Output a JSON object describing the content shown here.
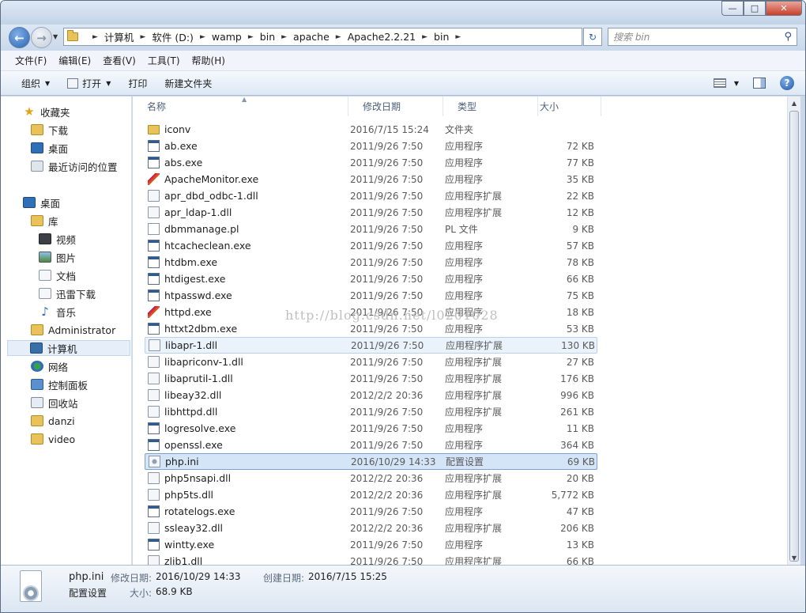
{
  "window": {
    "min_glyph": "—",
    "max_glyph": "□",
    "close_glyph": "✕"
  },
  "address": {
    "crumbs": [
      "计算机",
      "软件 (D:)",
      "wamp",
      "bin",
      "apache",
      "Apache2.2.21",
      "bin"
    ],
    "search_placeholder": "搜索 bin"
  },
  "menu": [
    "文件(F)",
    "编辑(E)",
    "查看(V)",
    "工具(T)",
    "帮助(H)"
  ],
  "commands": {
    "organize": "组织",
    "open": "打开",
    "print": "打印",
    "new_folder": "新建文件夹"
  },
  "nav": {
    "favorites": "收藏夹",
    "downloads": "下载",
    "desktop_fav": "桌面",
    "recent": "最近访问的位置",
    "desktop": "桌面",
    "libraries": "库",
    "videos": "视频",
    "pictures": "图片",
    "documents": "文档",
    "xunlei": "迅雷下载",
    "music": "音乐",
    "admin": "Administrator",
    "computer": "计算机",
    "network": "网络",
    "control_panel": "控制面板",
    "recycle": "回收站",
    "danzi": "danzi",
    "video": "video"
  },
  "columns": {
    "name": "名称",
    "date": "修改日期",
    "type": "类型",
    "size": "大小"
  },
  "files": [
    {
      "name": "iconv",
      "date": "2016/7/15 15:24",
      "type": "文件夹",
      "size": "",
      "icon": "folder"
    },
    {
      "name": "ab.exe",
      "date": "2011/9/26 7:50",
      "type": "应用程序",
      "size": "72 KB",
      "icon": "exe"
    },
    {
      "name": "abs.exe",
      "date": "2011/9/26 7:50",
      "type": "应用程序",
      "size": "77 KB",
      "icon": "exe"
    },
    {
      "name": "ApacheMonitor.exe",
      "date": "2011/9/26 7:50",
      "type": "应用程序",
      "size": "35 KB",
      "icon": "feather"
    },
    {
      "name": "apr_dbd_odbc-1.dll",
      "date": "2011/9/26 7:50",
      "type": "应用程序扩展",
      "size": "22 KB",
      "icon": "dll"
    },
    {
      "name": "apr_ldap-1.dll",
      "date": "2011/9/26 7:50",
      "type": "应用程序扩展",
      "size": "12 KB",
      "icon": "dll"
    },
    {
      "name": "dbmmanage.pl",
      "date": "2011/9/26 7:50",
      "type": "PL 文件",
      "size": "9 KB",
      "icon": "pl"
    },
    {
      "name": "htcacheclean.exe",
      "date": "2011/9/26 7:50",
      "type": "应用程序",
      "size": "57 KB",
      "icon": "exe"
    },
    {
      "name": "htdbm.exe",
      "date": "2011/9/26 7:50",
      "type": "应用程序",
      "size": "78 KB",
      "icon": "exe"
    },
    {
      "name": "htdigest.exe",
      "date": "2011/9/26 7:50",
      "type": "应用程序",
      "size": "66 KB",
      "icon": "exe"
    },
    {
      "name": "htpasswd.exe",
      "date": "2011/9/26 7:50",
      "type": "应用程序",
      "size": "75 KB",
      "icon": "exe"
    },
    {
      "name": "httpd.exe",
      "date": "2011/9/26 7:50",
      "type": "应用程序",
      "size": "18 KB",
      "icon": "feather"
    },
    {
      "name": "httxt2dbm.exe",
      "date": "2011/9/26 7:50",
      "type": "应用程序",
      "size": "53 KB",
      "icon": "exe"
    },
    {
      "name": "libapr-1.dll",
      "date": "2011/9/26 7:50",
      "type": "应用程序扩展",
      "size": "130 KB",
      "icon": "dll",
      "state": "hl"
    },
    {
      "name": "libapriconv-1.dll",
      "date": "2011/9/26 7:50",
      "type": "应用程序扩展",
      "size": "27 KB",
      "icon": "dll"
    },
    {
      "name": "libaprutil-1.dll",
      "date": "2011/9/26 7:50",
      "type": "应用程序扩展",
      "size": "176 KB",
      "icon": "dll"
    },
    {
      "name": "libeay32.dll",
      "date": "2012/2/2 20:36",
      "type": "应用程序扩展",
      "size": "996 KB",
      "icon": "dll"
    },
    {
      "name": "libhttpd.dll",
      "date": "2011/9/26 7:50",
      "type": "应用程序扩展",
      "size": "261 KB",
      "icon": "dll"
    },
    {
      "name": "logresolve.exe",
      "date": "2011/9/26 7:50",
      "type": "应用程序",
      "size": "11 KB",
      "icon": "exe"
    },
    {
      "name": "openssl.exe",
      "date": "2011/9/26 7:50",
      "type": "应用程序",
      "size": "364 KB",
      "icon": "exe"
    },
    {
      "name": "php.ini",
      "date": "2016/10/29 14:33",
      "type": "配置设置",
      "size": "69 KB",
      "icon": "ini",
      "state": "sel"
    },
    {
      "name": "php5nsapi.dll",
      "date": "2012/2/2 20:36",
      "type": "应用程序扩展",
      "size": "20 KB",
      "icon": "dll"
    },
    {
      "name": "php5ts.dll",
      "date": "2012/2/2 20:36",
      "type": "应用程序扩展",
      "size": "5,772 KB",
      "icon": "dll"
    },
    {
      "name": "rotatelogs.exe",
      "date": "2011/9/26 7:50",
      "type": "应用程序",
      "size": "47 KB",
      "icon": "exe"
    },
    {
      "name": "ssleay32.dll",
      "date": "2012/2/2 20:36",
      "type": "应用程序扩展",
      "size": "206 KB",
      "icon": "dll"
    },
    {
      "name": "wintty.exe",
      "date": "2011/9/26 7:50",
      "type": "应用程序",
      "size": "13 KB",
      "icon": "exe"
    },
    {
      "name": "zlib1.dll",
      "date": "2011/9/26 7:50",
      "type": "应用程序扩展",
      "size": "66 KB",
      "icon": "dll"
    }
  ],
  "watermark": "http://blog.csdn.net/l0201028",
  "details": {
    "filename": "php.ini",
    "filetype": "配置设置",
    "modified_label": "修改日期:",
    "modified": "2016/10/29 14:33",
    "created_label": "创建日期:",
    "created": "2016/7/15 15:25",
    "size_label": "大小:",
    "size": "68.9 KB"
  }
}
